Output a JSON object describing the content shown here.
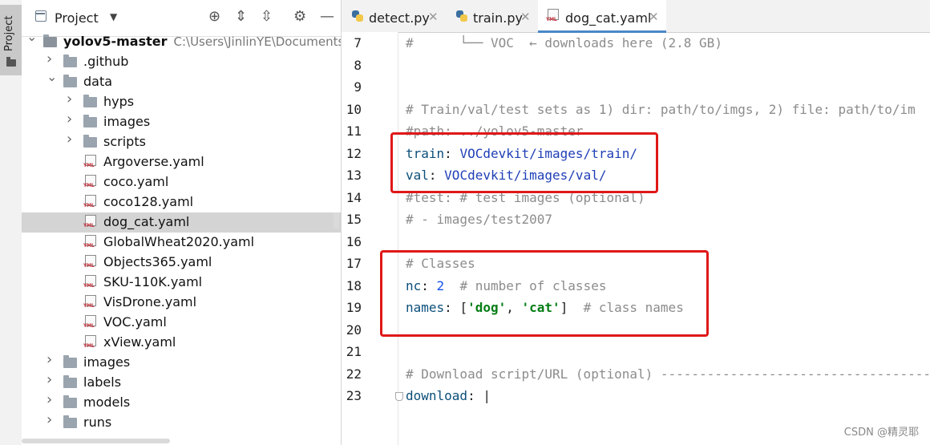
{
  "toolstrip": {
    "project_tab": "Project"
  },
  "project_panel": {
    "title": "Project",
    "tree": [
      {
        "label": "yolov5-master",
        "path": "C:\\Users\\JinlinYE\\Documents\\YE",
        "type": "folder",
        "depth": 0,
        "expanded": true,
        "bold": true,
        "selected": false
      },
      {
        "label": ".github",
        "type": "folder",
        "depth": 1,
        "expanded": false,
        "selected": false
      },
      {
        "label": "data",
        "type": "folder",
        "depth": 1,
        "expanded": true,
        "selected": false
      },
      {
        "label": "hyps",
        "type": "folder",
        "depth": 2,
        "expanded": false,
        "selected": false
      },
      {
        "label": "images",
        "type": "folder",
        "depth": 2,
        "expanded": false,
        "selected": false
      },
      {
        "label": "scripts",
        "type": "folder",
        "depth": 2,
        "expanded": false,
        "selected": false
      },
      {
        "label": "Argoverse.yaml",
        "type": "yaml",
        "depth": 2,
        "selected": false
      },
      {
        "label": "coco.yaml",
        "type": "yaml",
        "depth": 2,
        "selected": false
      },
      {
        "label": "coco128.yaml",
        "type": "yaml",
        "depth": 2,
        "selected": false
      },
      {
        "label": "dog_cat.yaml",
        "type": "yaml",
        "depth": 2,
        "selected": true
      },
      {
        "label": "GlobalWheat2020.yaml",
        "type": "yaml",
        "depth": 2,
        "selected": false
      },
      {
        "label": "Objects365.yaml",
        "type": "yaml",
        "depth": 2,
        "selected": false
      },
      {
        "label": "SKU-110K.yaml",
        "type": "yaml",
        "depth": 2,
        "selected": false
      },
      {
        "label": "VisDrone.yaml",
        "type": "yaml",
        "depth": 2,
        "selected": false
      },
      {
        "label": "VOC.yaml",
        "type": "yaml",
        "depth": 2,
        "selected": false
      },
      {
        "label": "xView.yaml",
        "type": "yaml",
        "depth": 2,
        "selected": false
      },
      {
        "label": "images",
        "type": "folder",
        "depth": 1,
        "expanded": false,
        "selected": false
      },
      {
        "label": "labels",
        "type": "folder",
        "depth": 1,
        "expanded": false,
        "selected": false
      },
      {
        "label": "models",
        "type": "folder",
        "depth": 1,
        "expanded": false,
        "selected": false
      },
      {
        "label": "runs",
        "type": "folder",
        "depth": 1,
        "expanded": false,
        "selected": false
      }
    ]
  },
  "tabs": [
    {
      "label": "detect.py",
      "icon": "python-icon",
      "active": false
    },
    {
      "label": "train.py",
      "icon": "python-icon",
      "active": false
    },
    {
      "label": "dog_cat.yaml",
      "icon": "yaml-icon",
      "active": true
    }
  ],
  "yml_tag": "YML",
  "editor": {
    "lines": [
      {
        "num": "7",
        "parts": [
          {
            "t": "#      └── VOC  ← downloads here (2.8 GB)",
            "c": "c-com"
          }
        ]
      },
      {
        "num": "8",
        "parts": []
      },
      {
        "num": "9",
        "parts": []
      },
      {
        "num": "10",
        "parts": [
          {
            "t": "# Train/val/test sets as 1) dir: path/to/imgs, 2) file: path/to/im",
            "c": "c-com"
          }
        ]
      },
      {
        "num": "11",
        "parts": [
          {
            "t": "#path: ../yolov5-master",
            "c": "c-com"
          }
        ]
      },
      {
        "num": "12",
        "parts": [
          {
            "t": "train",
            "c": "c-key"
          },
          {
            "t": ": ",
            "c": "c-punc"
          },
          {
            "t": "VOCdevkit/images/train/",
            "c": "c-val"
          }
        ]
      },
      {
        "num": "13",
        "parts": [
          {
            "t": "val",
            "c": "c-key"
          },
          {
            "t": ": ",
            "c": "c-punc"
          },
          {
            "t": "VOCdevkit/images/val/",
            "c": "c-val"
          }
        ]
      },
      {
        "num": "14",
        "parts": [
          {
            "t": "#test: # test images (optional)",
            "c": "c-com"
          }
        ]
      },
      {
        "num": "15",
        "parts": [
          {
            "t": "# - images/test2007",
            "c": "c-com"
          }
        ]
      },
      {
        "num": "16",
        "parts": []
      },
      {
        "num": "17",
        "parts": [
          {
            "t": "# Classes",
            "c": "c-com"
          }
        ]
      },
      {
        "num": "18",
        "parts": [
          {
            "t": "nc",
            "c": "c-key"
          },
          {
            "t": ": ",
            "c": "c-punc"
          },
          {
            "t": "2",
            "c": "c-num"
          },
          {
            "t": "  # number of classes",
            "c": "c-com"
          }
        ]
      },
      {
        "num": "19",
        "parts": [
          {
            "t": "names",
            "c": "c-key"
          },
          {
            "t": ": [",
            "c": "c-punc"
          },
          {
            "t": "'dog'",
            "c": "c-str"
          },
          {
            "t": ", ",
            "c": "c-punc"
          },
          {
            "t": "'cat'",
            "c": "c-str"
          },
          {
            "t": "]",
            "c": "c-punc"
          },
          {
            "t": "  # class names",
            "c": "c-com"
          }
        ]
      },
      {
        "num": "20",
        "parts": []
      },
      {
        "num": "21",
        "parts": []
      },
      {
        "num": "22",
        "parts": [
          {
            "t": "# Download script/URL (optional) -----------------------------------",
            "c": "c-com"
          }
        ]
      },
      {
        "num": "23",
        "parts": [
          {
            "t": "download",
            "c": "c-key"
          },
          {
            "t": ": |",
            "c": "c-punc"
          }
        ]
      }
    ]
  },
  "watermark": "CSDN @精灵耶",
  "colors": {
    "highlight_box": "#e01818",
    "selection": "#d4d4d4",
    "active_tab_underline": "#4a88c7"
  }
}
